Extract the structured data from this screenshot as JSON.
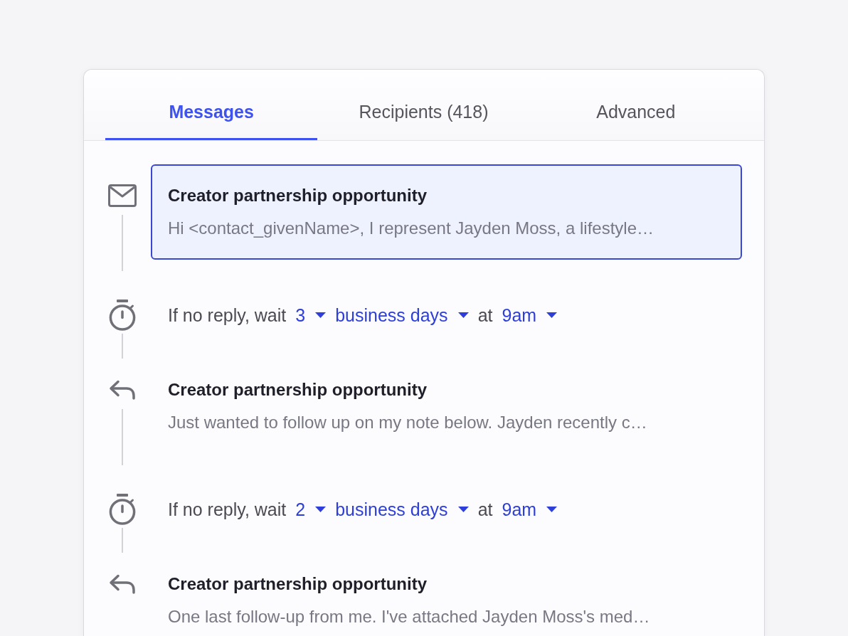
{
  "tabs": [
    {
      "label": "Messages",
      "selected": true
    },
    {
      "label": "Recipients (418)",
      "selected": false
    },
    {
      "label": "Advanced",
      "selected": false
    }
  ],
  "steps": [
    {
      "kind": "email",
      "subject": "Creator partnership opportunity",
      "preview": "Hi <contact_givenName>, I represent Jayden Moss, a lifestyle…",
      "selected": true
    },
    {
      "kind": "wait",
      "label": "If no reply, wait",
      "count": "3",
      "unit": "business days",
      "at_text": "at",
      "time": "9am"
    },
    {
      "kind": "reply",
      "subject": "Creator partnership opportunity",
      "preview": "Just wanted to follow up on my note below. Jayden recently c…",
      "selected": false
    },
    {
      "kind": "wait",
      "label": "If no reply, wait",
      "count": "2",
      "unit": "business days",
      "at_text": "at",
      "time": "9am"
    },
    {
      "kind": "reply",
      "subject": "Creator partnership opportunity",
      "preview": "One last follow-up from me. I've attached Jayden Moss's med…",
      "selected": false
    }
  ]
}
